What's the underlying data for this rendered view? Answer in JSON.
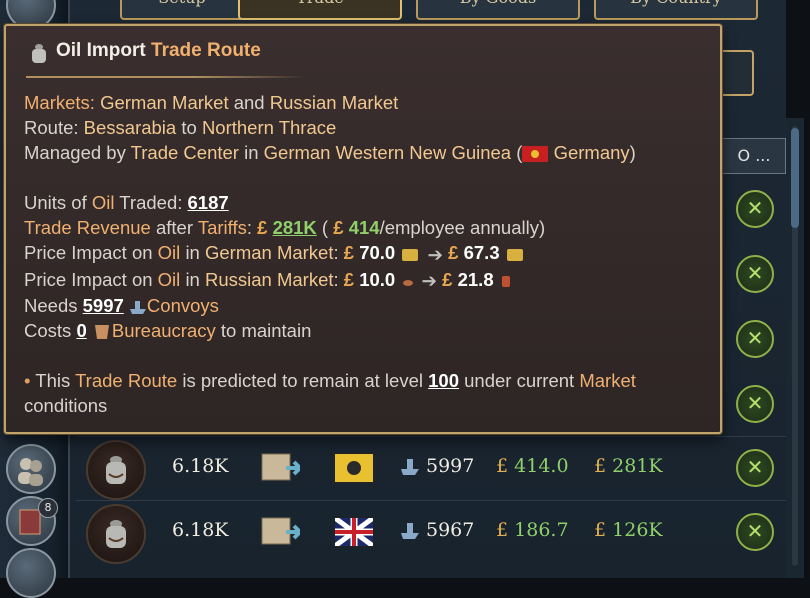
{
  "tabs": [
    "Setup",
    "Trade",
    "By Goods",
    "By Country"
  ],
  "sort_label": "O ...",
  "tooltip": {
    "title_goods": "Oil Import",
    "title_type": "Trade Route",
    "markets_label": "Markets:",
    "market_a": "German Market",
    "and_word": "and",
    "market_b": "Russian Market",
    "route_label": "Route:",
    "route_from": "Bessarabia",
    "to_word": "to",
    "route_to": "Northern Thrace",
    "managed_label": "Managed by",
    "managed_by": "Trade Center",
    "in_word": "in",
    "managed_state": "German Western New Guinea",
    "managed_country": "Germany",
    "units_label_pre": "Units of",
    "units_good": "Oil",
    "units_label_post": "Traded:",
    "units_value": "6187",
    "revenue_label": "Trade Revenue",
    "after_word": "after",
    "tariffs_label": "Tariffs",
    "revenue_value": "281K",
    "revenue_annual": "414",
    "revenue_annual_suffix": "/employee annually)",
    "impact1_pre": "Price Impact on",
    "impact1_good": "Oil",
    "impact1_in": "in",
    "impact1_market": "German Market",
    "impact1_from": "70.0",
    "impact1_to": "67.3",
    "impact2_pre": "Price Impact on",
    "impact2_good": "Oil",
    "impact2_in": "in",
    "impact2_market": "Russian Market",
    "impact2_from": "10.0",
    "impact2_to": "21.8",
    "needs_label": "Needs",
    "needs_value": "5997",
    "needs_unit": "Convoys",
    "costs_label": "Costs",
    "costs_value": "0",
    "costs_unit": "Bureaucracy",
    "costs_suffix": "to maintain",
    "predict_pre": "This",
    "predict_route": "Trade Route",
    "predict_mid": "is predicted to remain at level",
    "predict_level": "100",
    "predict_under": "under current",
    "predict_market": "Market",
    "predict_end": "conditions"
  },
  "rows": [
    {
      "units": "6.18K",
      "convoys": "5997",
      "money1": "414.0",
      "money2": "281K",
      "flag": "russia"
    },
    {
      "units": "6.18K",
      "convoys": "5967",
      "money1": "186.7",
      "money2": "126K",
      "flag": "uk"
    }
  ],
  "sidebar_badge": "8",
  "colors": {
    "gold": "#c2a46a",
    "green": "#8fd06a",
    "accent": "#f0b070"
  }
}
